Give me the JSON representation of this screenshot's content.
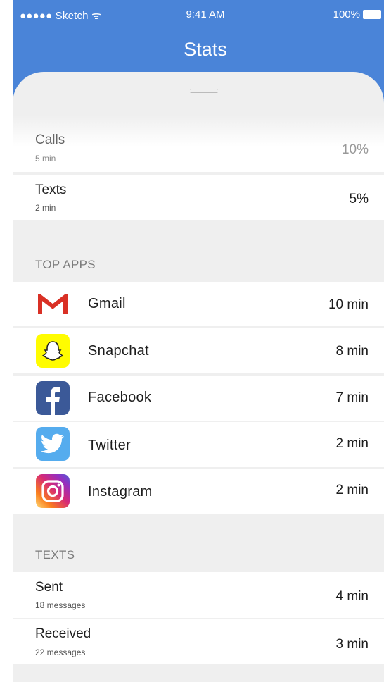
{
  "status_bar": {
    "carrier": "●●●●● Sketch ᯤ",
    "time": "9:41 AM",
    "battery": "100%"
  },
  "nav": {
    "title": "Stats"
  },
  "usage": [
    {
      "label": "Calls",
      "sub": "5 min",
      "value": "10%"
    },
    {
      "label": "Texts",
      "sub": "2 min",
      "value": "5%"
    }
  ],
  "top_apps": {
    "header": "TOP APPS",
    "items": [
      {
        "name": "Gmail",
        "value": "10 min",
        "icon": "gmail-icon"
      },
      {
        "name": "Snapchat",
        "value": "8 min",
        "icon": "snapchat-icon"
      },
      {
        "name": "Facebook",
        "value": "7 min",
        "icon": "facebook-icon"
      },
      {
        "name": "Twitter",
        "value": "2 min",
        "icon": "twitter-icon"
      },
      {
        "name": "Instagram",
        "value": "2 min",
        "icon": "instagram-icon"
      }
    ]
  },
  "texts": {
    "header": "TEXTS",
    "items": [
      {
        "label": "Sent",
        "sub": "18 messages",
        "value": "4 min"
      },
      {
        "label": "Received",
        "sub": "22 messages",
        "value": "3 min"
      }
    ]
  },
  "colors": {
    "nav_blue": "#4a84d8",
    "gmail_red": "#d93025",
    "snapchat_yellow": "#fffc00",
    "facebook_blue": "#3b5998",
    "twitter_blue": "#55acee"
  }
}
